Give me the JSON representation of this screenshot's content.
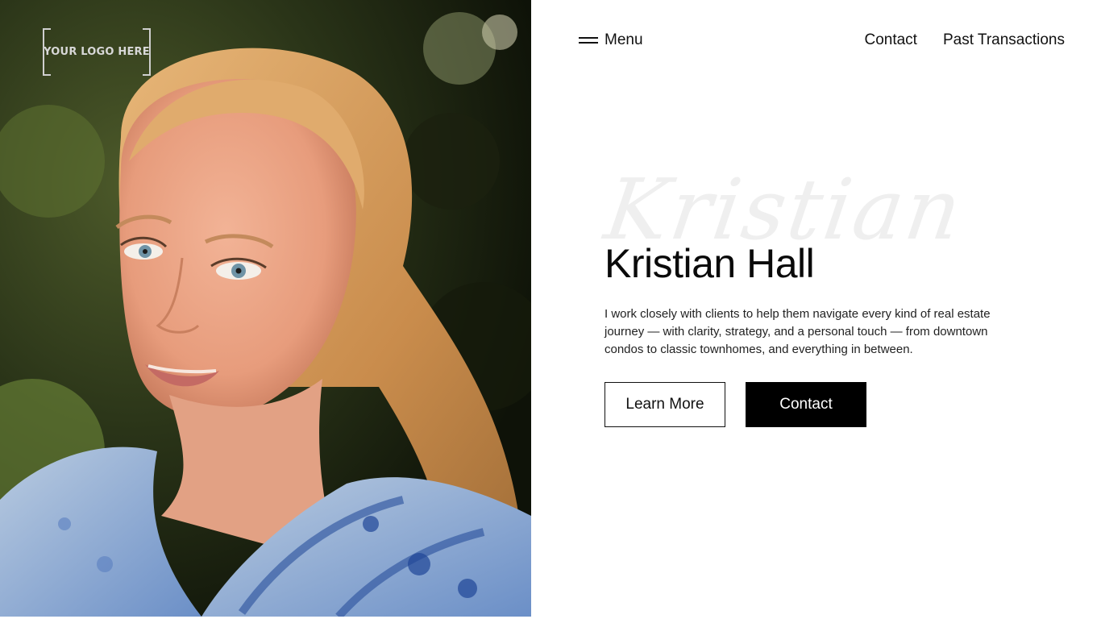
{
  "logo": {
    "text": "YOUR LOGO HERE"
  },
  "header": {
    "menu_label": "Menu",
    "nav": [
      {
        "label": "Contact"
      },
      {
        "label": "Past Transactions"
      }
    ]
  },
  "hero": {
    "script_text": "Kristian",
    "title": "Kristian Hall",
    "description": "I work closely with clients to help them navigate every kind of real estate journey — with clarity, strategy, and a personal touch — from downtown condos to classic townhomes, and everything in between.",
    "learn_more_label": "Learn More",
    "contact_label": "Contact"
  },
  "colors": {
    "text": "#111111",
    "button_solid_bg": "#000000",
    "button_solid_text": "#ffffff",
    "script_watermark": "#efefef"
  }
}
